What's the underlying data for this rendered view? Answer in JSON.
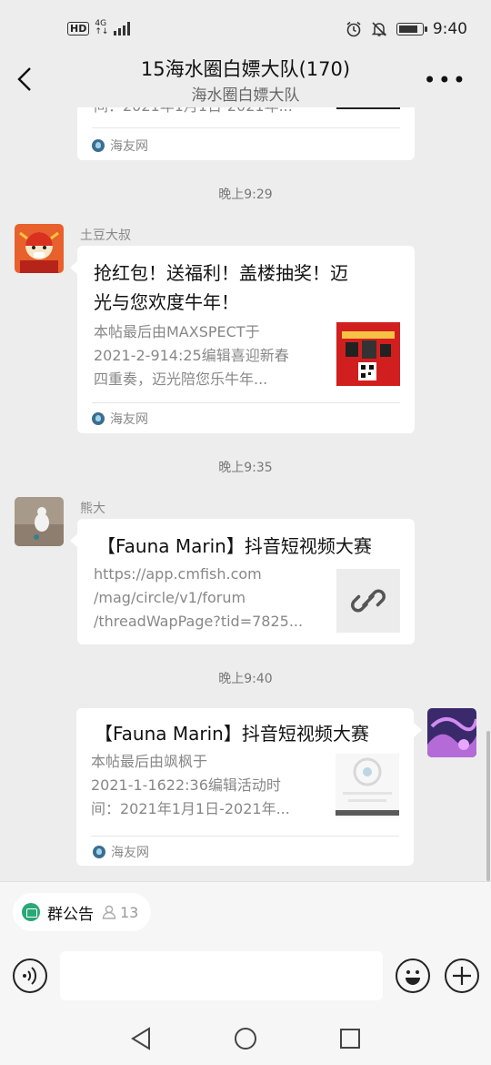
{
  "status_bar": {
    "hd": "HD",
    "network": "4G",
    "network_sub": "↑↓",
    "time": "9:40"
  },
  "header": {
    "title": "15海水圈白嫖大队(170)",
    "subtitle": "海水圈白嫖大队",
    "more": "•••"
  },
  "messages": [
    {
      "type": "partial_card",
      "desc_tail": "间：2021年1月1日-2021年...",
      "source": "海友网"
    },
    {
      "timestamp": "晚上9:29",
      "sender": "土豆大叔",
      "title_line1": "抢红包！送福利！盖楼抽奖！迈",
      "title_line2": "光与您欢度牛年！",
      "desc_line1": "本帖最后由MAXSPECT于",
      "desc_line2": "2021-2-914:25编辑喜迎新春",
      "desc_line3": "四重奏，迈光陪您乐牛年...",
      "source": "海友网",
      "thumb_icon": "promo-poster-image"
    },
    {
      "timestamp": "晚上9:35",
      "sender": "熊大",
      "title_line1": "【Fauna Marin】抖音短视频大赛",
      "desc_line1": "https://app.cmfish.com",
      "desc_line2": "/mag/circle/v1/forum",
      "desc_line3": "/threadWapPage?tid=7825...",
      "thumb_icon": "link-icon"
    },
    {
      "timestamp": "晚上9:40",
      "sender": "",
      "title_line1": "【Fauna Marin】抖音短视频大赛",
      "desc_line1": "本帖最后由飒枫于",
      "desc_line2": "2021-1-1622:36编辑活动时",
      "desc_line3": "间：2021年1月1日-2021年...",
      "source": "海友网",
      "thumb_icon": "poster-thumbnail-image"
    }
  ],
  "bottom": {
    "notice_label": "群公告",
    "notice_count": "13",
    "input_value": ""
  },
  "colors": {
    "background": "#ededed",
    "card": "#ffffff",
    "accent_green": "#2aa876"
  }
}
